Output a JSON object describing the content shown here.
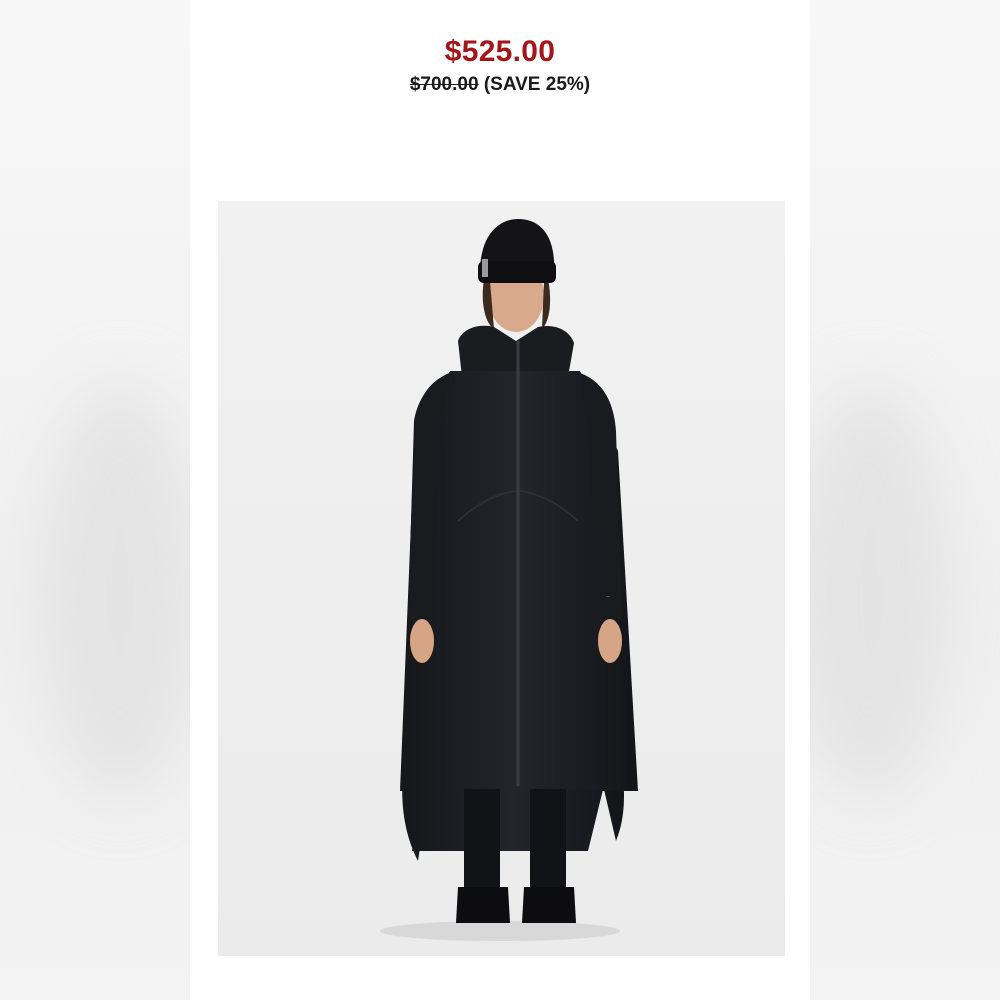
{
  "product": {
    "sale_price": "$525.00",
    "original_price": "$700.00",
    "savings_text": "(SAVE 25%)",
    "image_alt_icon": "product-photo-long-black-parka"
  },
  "colors": {
    "sale_price": "#a4161a",
    "text": "#1a1a1a",
    "photo_background": "#efefef",
    "garment": "#1c1d21"
  }
}
